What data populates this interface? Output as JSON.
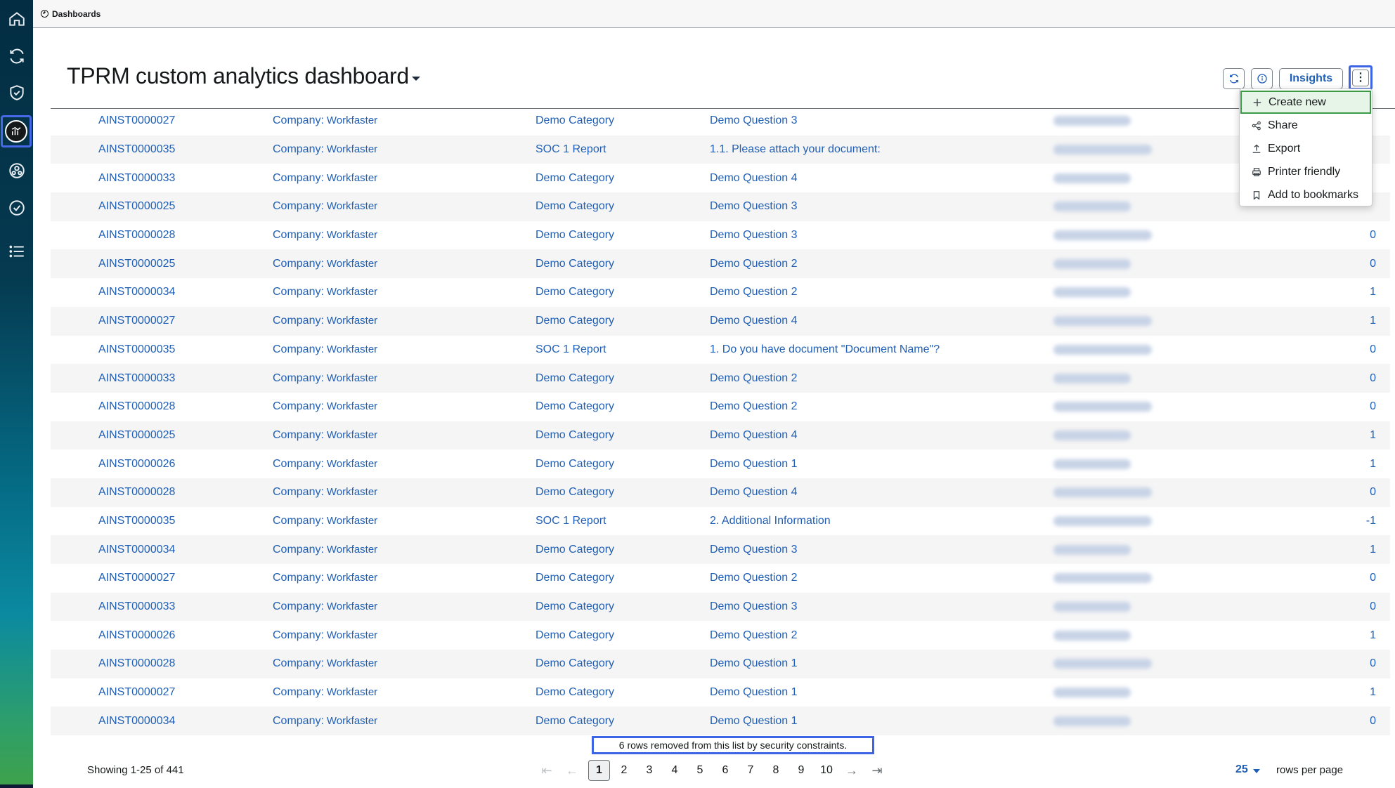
{
  "breadcrumb": {
    "label": "Dashboards"
  },
  "title": "TPRM custom analytics dashboard",
  "actions": {
    "insights": "Insights",
    "more": "⋮"
  },
  "menu": [
    {
      "icon": "plus-icon",
      "label": "Create new"
    },
    {
      "icon": "share-icon",
      "label": "Share"
    },
    {
      "icon": "export-icon",
      "label": "Export"
    },
    {
      "icon": "printer-icon",
      "label": "Printer friendly"
    },
    {
      "icon": "bookmark-icon",
      "label": "Add to bookmarks"
    }
  ],
  "company_prefix": "Company:",
  "rows": [
    {
      "id": "AINST0000027",
      "company": "Workfaster",
      "category": "Demo Category",
      "question": "Demo Question 3",
      "value": ""
    },
    {
      "id": "AINST0000035",
      "company": "Workfaster",
      "category": "SOC 1 Report",
      "question": "1.1. Please attach your document:",
      "value": ""
    },
    {
      "id": "AINST0000033",
      "company": "Workfaster",
      "category": "Demo Category",
      "question": "Demo Question 4",
      "value": ""
    },
    {
      "id": "AINST0000025",
      "company": "Workfaster",
      "category": "Demo Category",
      "question": "Demo Question 3",
      "value": ""
    },
    {
      "id": "AINST0000028",
      "company": "Workfaster",
      "category": "Demo Category",
      "question": "Demo Question 3",
      "value": "0"
    },
    {
      "id": "AINST0000025",
      "company": "Workfaster",
      "category": "Demo Category",
      "question": "Demo Question 2",
      "value": "0"
    },
    {
      "id": "AINST0000034",
      "company": "Workfaster",
      "category": "Demo Category",
      "question": "Demo Question 2",
      "value": "1"
    },
    {
      "id": "AINST0000027",
      "company": "Workfaster",
      "category": "Demo Category",
      "question": "Demo Question 4",
      "value": "1"
    },
    {
      "id": "AINST0000035",
      "company": "Workfaster",
      "category": "SOC 1 Report",
      "question": "1. Do you have document \"Document Name\"?",
      "value": "0"
    },
    {
      "id": "AINST0000033",
      "company": "Workfaster",
      "category": "Demo Category",
      "question": "Demo Question 2",
      "value": "0"
    },
    {
      "id": "AINST0000028",
      "company": "Workfaster",
      "category": "Demo Category",
      "question": "Demo Question 2",
      "value": "0"
    },
    {
      "id": "AINST0000025",
      "company": "Workfaster",
      "category": "Demo Category",
      "question": "Demo Question 4",
      "value": "1"
    },
    {
      "id": "AINST0000026",
      "company": "Workfaster",
      "category": "Demo Category",
      "question": "Demo Question 1",
      "value": "1"
    },
    {
      "id": "AINST0000028",
      "company": "Workfaster",
      "category": "Demo Category",
      "question": "Demo Question 4",
      "value": "0"
    },
    {
      "id": "AINST0000035",
      "company": "Workfaster",
      "category": "SOC 1 Report",
      "question": "2. Additional Information",
      "value": "-1"
    },
    {
      "id": "AINST0000034",
      "company": "Workfaster",
      "category": "Demo Category",
      "question": "Demo Question 3",
      "value": "1"
    },
    {
      "id": "AINST0000027",
      "company": "Workfaster",
      "category": "Demo Category",
      "question": "Demo Question 2",
      "value": "0"
    },
    {
      "id": "AINST0000033",
      "company": "Workfaster",
      "category": "Demo Category",
      "question": "Demo Question 3",
      "value": "0"
    },
    {
      "id": "AINST0000026",
      "company": "Workfaster",
      "category": "Demo Category",
      "question": "Demo Question 2",
      "value": "1"
    },
    {
      "id": "AINST0000028",
      "company": "Workfaster",
      "category": "Demo Category",
      "question": "Demo Question 1",
      "value": "0"
    },
    {
      "id": "AINST0000027",
      "company": "Workfaster",
      "category": "Demo Category",
      "question": "Demo Question 1",
      "value": "1"
    },
    {
      "id": "AINST0000034",
      "company": "Workfaster",
      "category": "Demo Category",
      "question": "Demo Question 1",
      "value": "0"
    }
  ],
  "notice": "6 rows removed from this list by security constraints.",
  "footer": {
    "showing": "Showing 1-25 of 441",
    "pages": [
      "1",
      "2",
      "3",
      "4",
      "5",
      "6",
      "7",
      "8",
      "9",
      "10"
    ],
    "current_page": "1",
    "rows_per_page": "25",
    "rows_per_page_label": "rows per page"
  },
  "colors": {
    "link": "#1f5fb5",
    "accent_outline": "#3e64e6",
    "menu_highlight": "#3a9a45"
  }
}
